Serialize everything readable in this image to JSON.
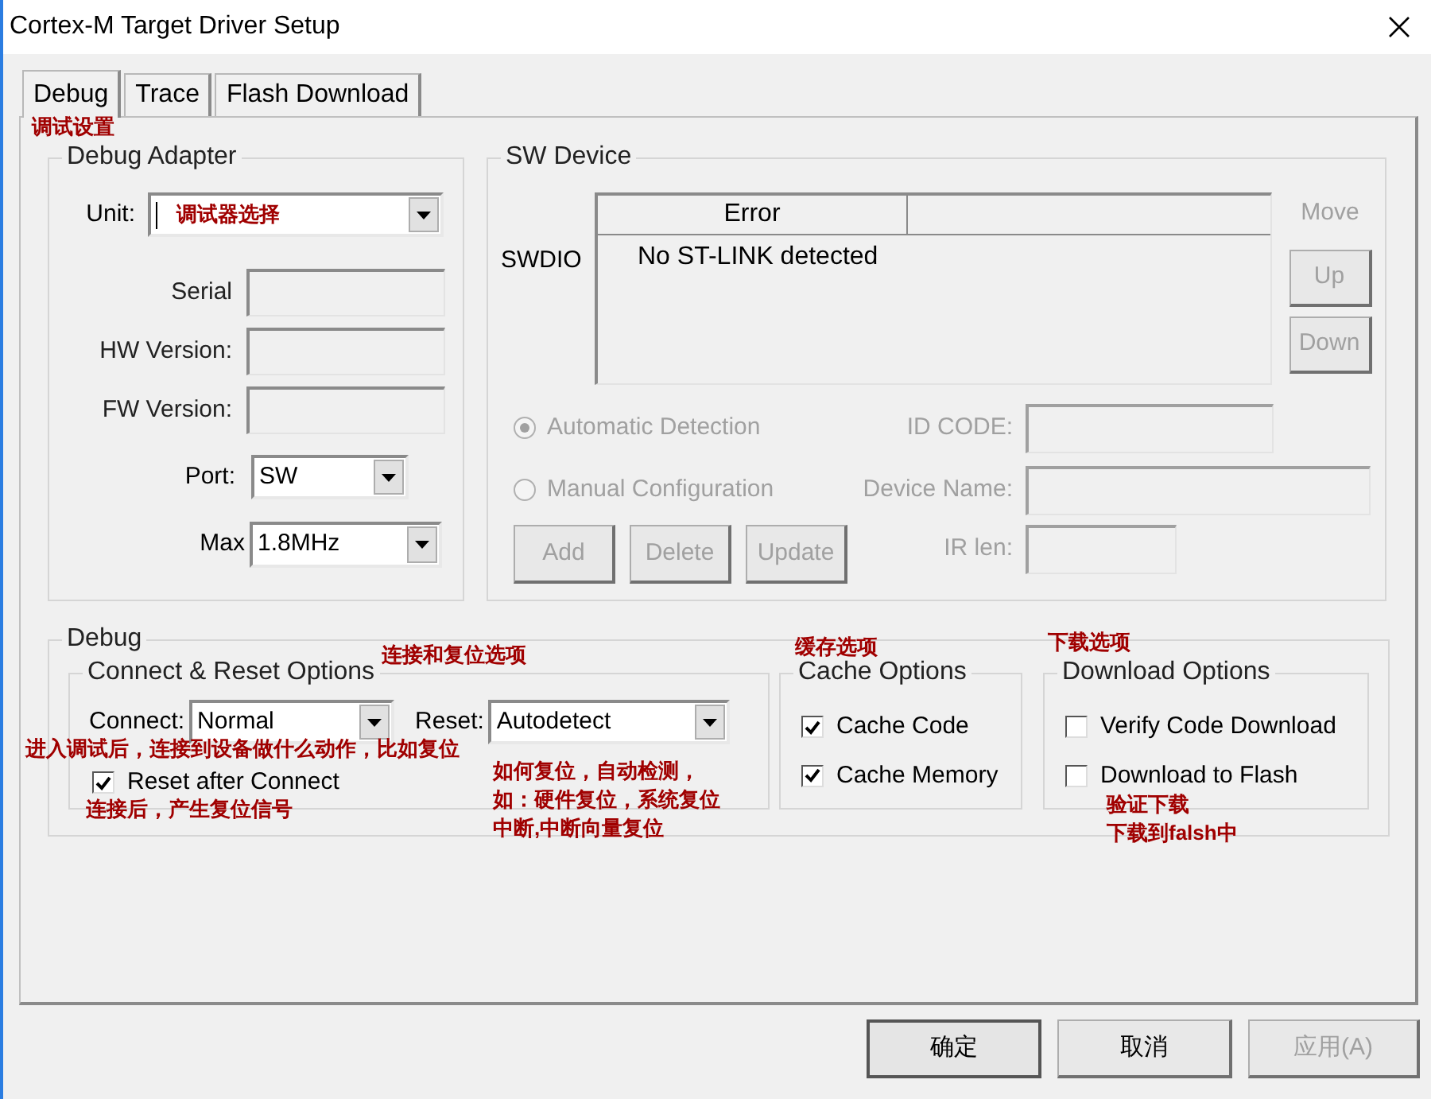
{
  "window": {
    "title": "Cortex-M Target Driver Setup"
  },
  "tabs": [
    {
      "label": "Debug",
      "selected": true
    },
    {
      "label": "Trace",
      "selected": false
    },
    {
      "label": "Flash Download",
      "selected": false
    }
  ],
  "debug_adapter": {
    "title": "Debug Adapter",
    "unit": {
      "label": "Unit:",
      "value": "调试器选择"
    },
    "info_fields": [
      {
        "label": "Serial"
      },
      {
        "label": "HW Version:"
      },
      {
        "label": "FW Version:"
      }
    ],
    "port": {
      "label": "Port:",
      "value": "SW"
    },
    "max": {
      "label": "Max",
      "value": "1.8MHz"
    }
  },
  "sw_device": {
    "title": "SW Device",
    "row_label": "SWDIO",
    "table": {
      "columns": [
        "Error"
      ],
      "rows": [
        [
          "No ST-LINK detected"
        ]
      ]
    },
    "move_label": "Move",
    "move_buttons": [
      {
        "label": "Up",
        "disabled": true
      },
      {
        "label": "Down",
        "disabled": true
      }
    ],
    "radios": [
      {
        "label": "Automatic Detection",
        "selected": true,
        "disabled": true
      },
      {
        "label": "Manual Configuration",
        "selected": false,
        "disabled": true
      }
    ],
    "fields": [
      {
        "label": "ID CODE:",
        "disabled": true
      },
      {
        "label": "Device Name:",
        "disabled": true
      },
      {
        "label": "IR len:",
        "disabled": true
      }
    ],
    "buttons": [
      {
        "label": "Add",
        "disabled": true
      },
      {
        "label": "Delete",
        "disabled": true
      },
      {
        "label": "Update",
        "disabled": true
      }
    ]
  },
  "debug": {
    "title": "Debug",
    "connect_reset": {
      "title": "Connect & Reset Options",
      "connect": {
        "label": "Connect:",
        "value": "Normal"
      },
      "reset": {
        "label": "Reset:",
        "value": "Autodetect"
      },
      "reset_after_connect": {
        "label": "Reset after Connect",
        "checked": true
      }
    },
    "cache_options": {
      "title": "Cache Options",
      "items": [
        {
          "label": "Cache Code",
          "checked": true
        },
        {
          "label": "Cache Memory",
          "checked": true
        }
      ]
    },
    "download_options": {
      "title": "Download Options",
      "items": [
        {
          "label": "Verify Code Download",
          "checked": false
        },
        {
          "label": "Download to Flash",
          "checked": false
        }
      ]
    }
  },
  "annotations": [
    {
      "text": "调试设置"
    },
    {
      "text": "连接和复位选项"
    },
    {
      "text": "缓存选项"
    },
    {
      "text": "下载选项"
    },
    {
      "text": "进入调试后，连接到设备做什么动作，比如复位"
    },
    {
      "text": "连接后，产生复位信号"
    },
    {
      "text": "如何复位，自动检测，"
    },
    {
      "text": "如：硬件复位，系统复位"
    },
    {
      "text": "中断,中断向量复位"
    },
    {
      "text": "验证下载"
    },
    {
      "text": "下载到falsh中"
    }
  ],
  "buttons": [
    {
      "label": "确定",
      "default": true,
      "disabled": false
    },
    {
      "label": "取消",
      "default": false,
      "disabled": false
    },
    {
      "label": "应用(A)",
      "default": false,
      "disabled": true
    }
  ]
}
